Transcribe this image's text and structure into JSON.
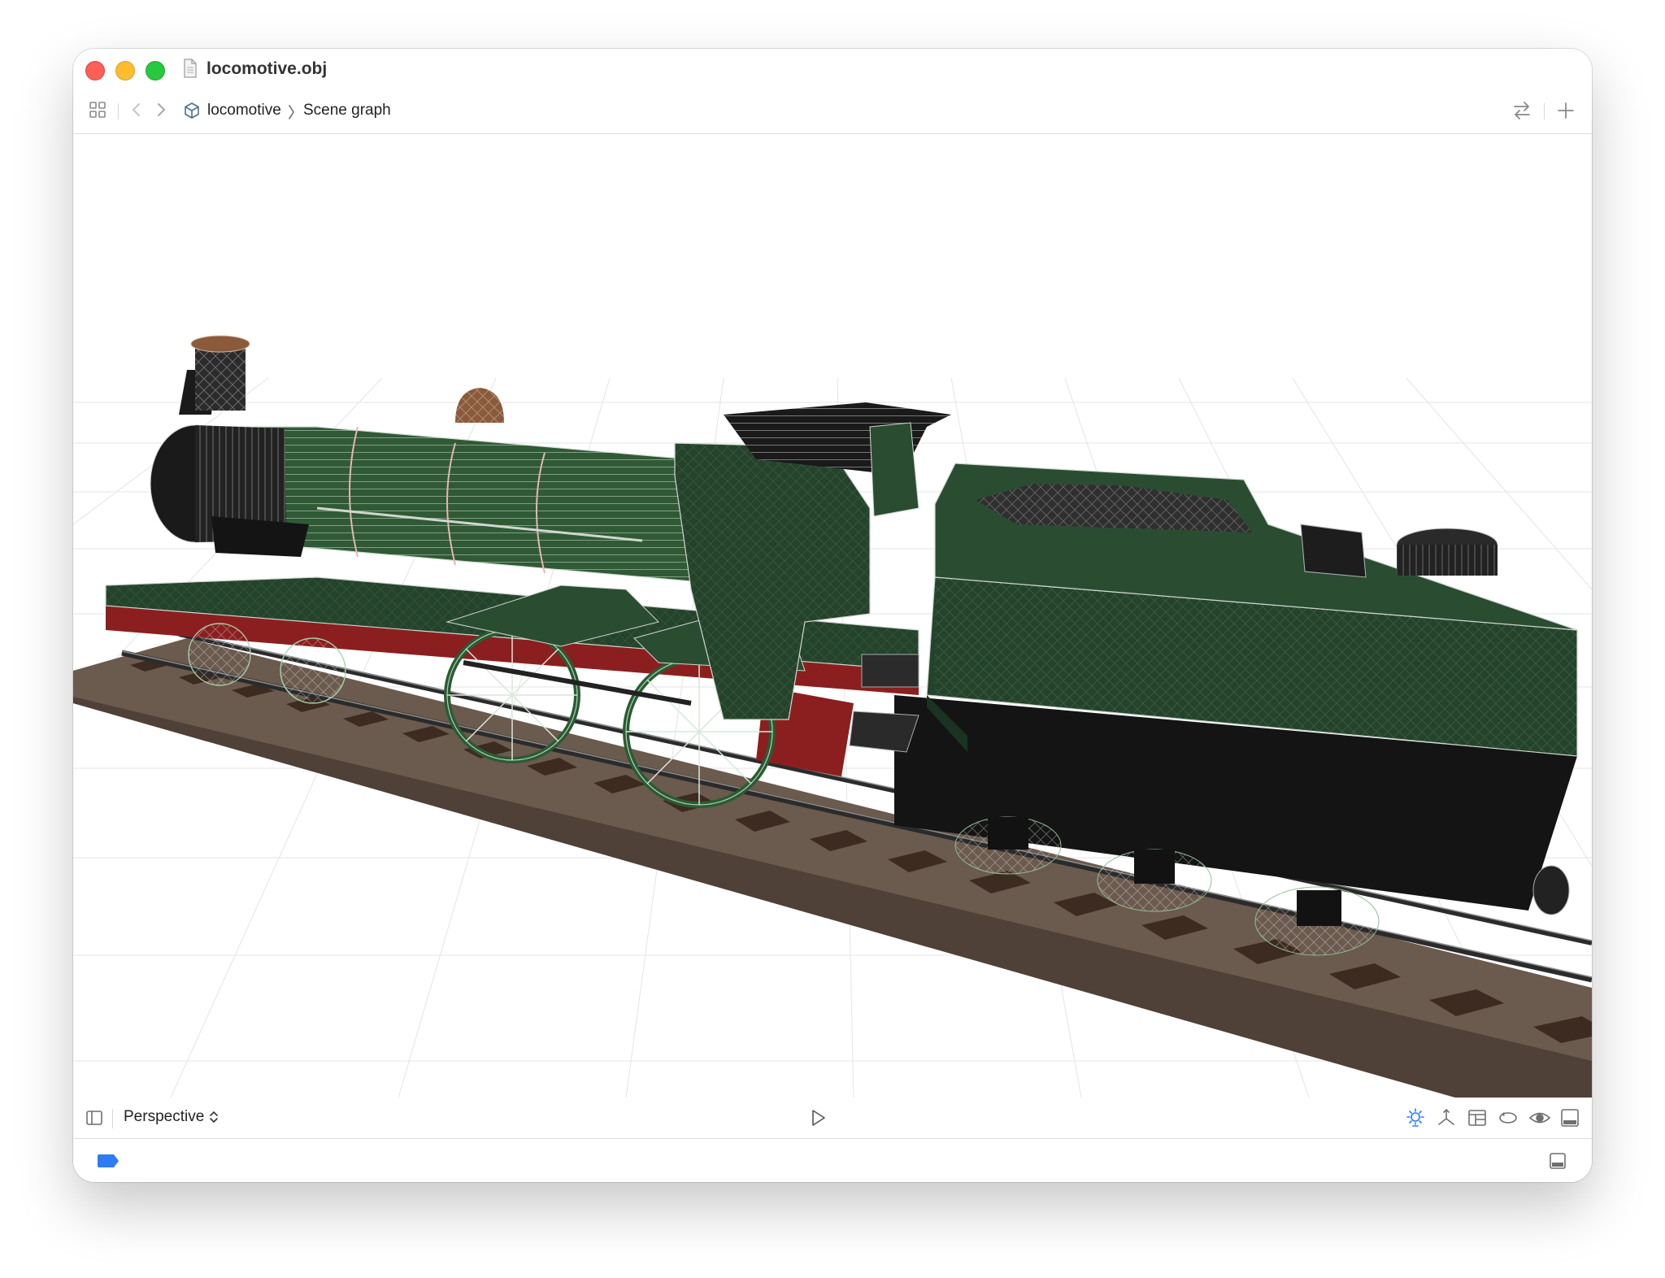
{
  "window": {
    "title": "locomotive.obj"
  },
  "breadcrumb": {
    "items": [
      "locomotive",
      "Scene graph"
    ],
    "separator": "〉"
  },
  "viewport": {
    "camera_mode": "Perspective",
    "scene_object": "locomotive",
    "colors": {
      "body_green": "#24432b",
      "boiler_green": "#2f5a35",
      "frame_red": "#8b1f1f",
      "smokebox_black": "#1a1a1a",
      "track_bed": "#6b5a4e",
      "sleepers": "#3d2a20",
      "dome_copper": "#8a5a3a",
      "grid": "#e6e6e6"
    }
  },
  "icons": {
    "titlebar": [
      "document-icon"
    ],
    "navbar": [
      "grid-view-icon",
      "back-chevron-icon",
      "forward-chevron-icon",
      "scene-cube-icon",
      "swap-arrows-icon",
      "plus-icon"
    ],
    "bottombar": [
      "sidebar-toggle-icon",
      "updown-chevron-icon",
      "play-icon",
      "lighting-icon",
      "axes-icon",
      "layout-icon",
      "loop-icon",
      "eye-icon",
      "bottom-panel-icon"
    ],
    "footer": [
      "tag-icon",
      "bottom-panel-icon"
    ]
  },
  "accent_color": "#2f7bf6"
}
